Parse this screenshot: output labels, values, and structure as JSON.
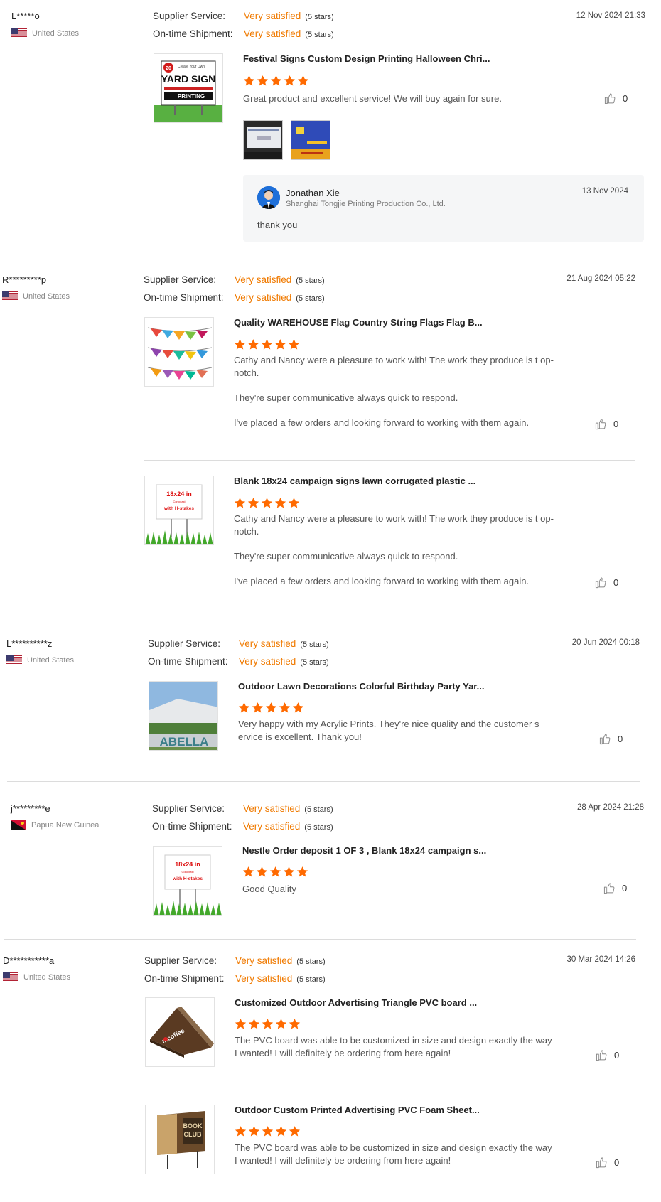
{
  "labels": {
    "supplier_service": "Supplier Service:",
    "ontime_shipment": "On-time Shipment:"
  },
  "colors": {
    "accent": "#f07a00",
    "star": "#ff6a00"
  },
  "icons": {
    "like": "thumbs-up-icon",
    "star": "star-icon"
  },
  "reviews": [
    {
      "user": "L*****o",
      "country": "United States",
      "date": "12 Nov 2024 21:33",
      "supplier_service": {
        "value": "Very satisfied",
        "stars": "(5 stars)"
      },
      "ontime_shipment": {
        "value": "Very satisfied",
        "stars": "(5 stars)"
      },
      "products": [
        {
          "title": "Festival Signs Custom Design Printing Halloween Chri...",
          "rating": 5,
          "text": [
            "Great product and excellent service! We will buy again for sure."
          ],
          "likes": "0",
          "thumb_text": {
            "badge": "20",
            "top": "Create Your Own",
            "main": "YARD SIGN",
            "brand": "PRINTING"
          }
        }
      ],
      "reply": {
        "name": "Jonathan Xie",
        "company": "Shanghai Tongjie Printing Production Co., Ltd.",
        "date": "13 Nov 2024",
        "message": "thank you"
      }
    },
    {
      "user": "R*********p",
      "country": "United States",
      "date": "21 Aug 2024 05:22",
      "supplier_service": {
        "value": "Very satisfied",
        "stars": "(5 stars)"
      },
      "ontime_shipment": {
        "value": "Very satisfied",
        "stars": "(5 stars)"
      },
      "products": [
        {
          "title": "Quality WAREHOUSE Flag Country String Flags Flag B...",
          "rating": 5,
          "text": [
            "Cathy and Nancy were a pleasure to work with! The work they produce is t op-notch.",
            "They're super communicative always quick to respond.",
            "I've placed a few orders and looking forward to working with them again."
          ],
          "likes": "0"
        },
        {
          "title": "Blank 18x24 campaign signs lawn corrugated plastic ...",
          "rating": 5,
          "text": [
            "Cathy and Nancy were a pleasure to work with! The work they produce is t op-notch.",
            "They're super communicative always quick to respond.",
            "I've placed a few orders and looking forward to working with them again."
          ],
          "likes": "0",
          "thumb_text": {
            "size": "18x24 in",
            "sub": "Coroplast",
            "stakes": "with H-stakes"
          }
        }
      ]
    },
    {
      "user": "L**********z",
      "country": "United States",
      "date": "20 Jun 2024 00:18",
      "supplier_service": {
        "value": "Very satisfied",
        "stars": "(5 stars)"
      },
      "ontime_shipment": {
        "value": "Very satisfied",
        "stars": "(5 stars)"
      },
      "products": [
        {
          "title": "Outdoor Lawn Decorations Colorful Birthday Party Yar...",
          "rating": 5,
          "text": [
            "Very happy with my Acrylic Prints. They're nice quality and the customer s ervice is excellent. Thank you!"
          ],
          "likes": "0",
          "thumb_text": {
            "word": "ABELLA"
          }
        }
      ]
    },
    {
      "user": "j*********e",
      "country": "Papua New Guinea",
      "date": "28 Apr 2024 21:28",
      "supplier_service": {
        "value": "Very satisfied",
        "stars": "(5 stars)"
      },
      "ontime_shipment": {
        "value": "Very satisfied",
        "stars": "(5 stars)"
      },
      "products": [
        {
          "title": "Nestle Order deposit 1 OF 3 , Blank 18x24 campaign s...",
          "rating": 5,
          "text": [
            "Good Quality"
          ],
          "likes": "0",
          "thumb_text": {
            "size": "18x24 in",
            "sub": "Coroplast",
            "stakes": "with H-stakes"
          }
        }
      ]
    },
    {
      "user": "D***********a",
      "country": "United States",
      "date": "30 Mar 2024 14:26",
      "supplier_service": {
        "value": "Very satisfied",
        "stars": "(5 stars)"
      },
      "ontime_shipment": {
        "value": "Very satisfied",
        "stars": "(5 stars)"
      },
      "products": [
        {
          "title": "Customized Outdoor Advertising Triangle PVC board ...",
          "rating": 5,
          "text": [
            "The PVC board was able to be customized in size and design exactly the way I wanted! I will definitely be ordering from here again!"
          ],
          "likes": "0",
          "thumb_text": {
            "brand": "mcoffee"
          }
        },
        {
          "title": "Outdoor Custom Printed Advertising PVC Foam Sheet...",
          "rating": 5,
          "text": [
            "The PVC board was able to be customized in size and design exactly the way I wanted! I will definitely be ordering from here again!"
          ],
          "likes": "0",
          "thumb_text": {
            "line1": "BOOK",
            "line2": "CLUB"
          }
        }
      ]
    }
  ]
}
